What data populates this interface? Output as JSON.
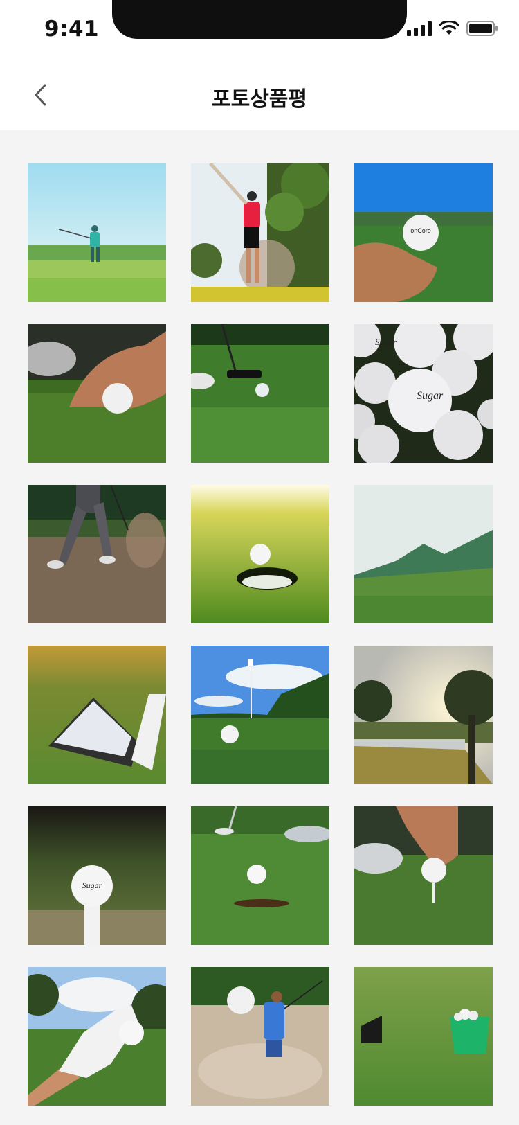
{
  "status": {
    "time": "9:41"
  },
  "header": {
    "title": "포토상품평",
    "back_icon": "chevron-left-icon"
  },
  "photos": [
    {
      "icon": "golfer-swing-photo"
    },
    {
      "icon": "golfer-red-shirt-photo"
    },
    {
      "icon": "hand-holding-ball-photo"
    },
    {
      "icon": "hand-placing-ball-photo"
    },
    {
      "icon": "putter-green-photo"
    },
    {
      "icon": "pile-of-balls-photo"
    },
    {
      "icon": "bunker-shot-photo"
    },
    {
      "icon": "ball-at-hole-photo"
    },
    {
      "icon": "mountain-course-photo"
    },
    {
      "icon": "ball-pyramid-photo"
    },
    {
      "icon": "flag-fairway-photo"
    },
    {
      "icon": "sunset-pond-photo"
    },
    {
      "icon": "ball-on-tee-photo"
    },
    {
      "icon": "putt-to-hole-photo"
    },
    {
      "icon": "hand-on-tee-photo"
    },
    {
      "icon": "gloved-hand-ball-photo"
    },
    {
      "icon": "sand-swing-photo"
    },
    {
      "icon": "ball-basket-photo"
    }
  ]
}
